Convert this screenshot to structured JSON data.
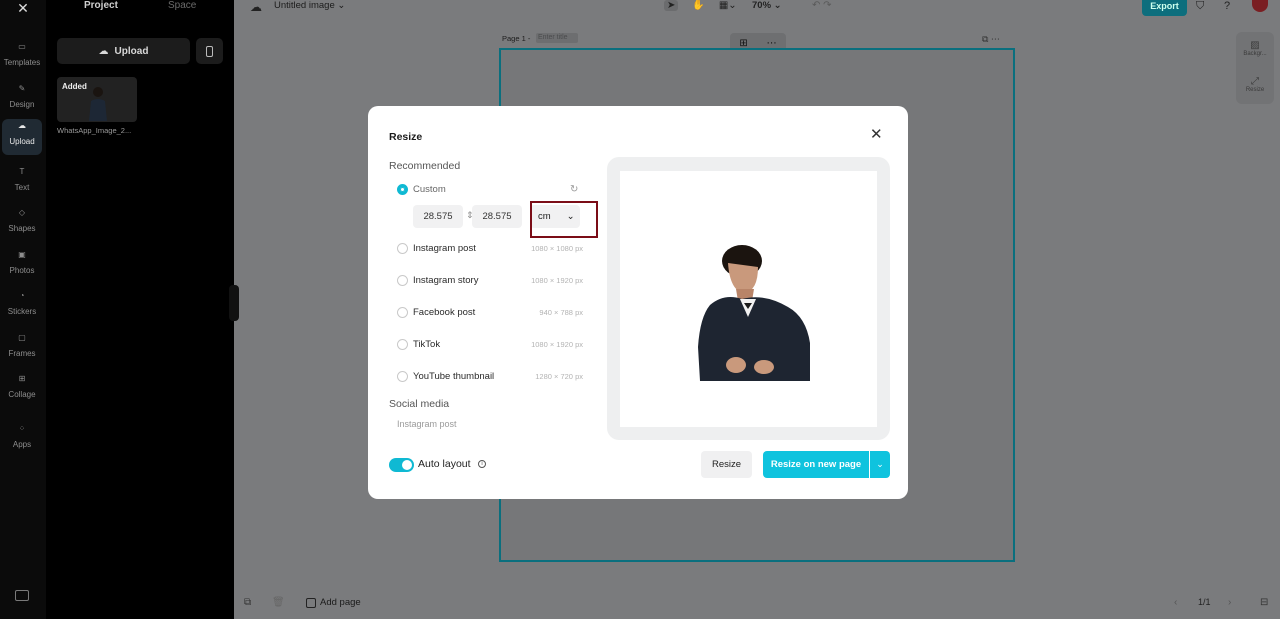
{
  "rail": {
    "items": [
      {
        "label": "Templates",
        "icon": "templates-icon"
      },
      {
        "label": "Design",
        "icon": "design-icon"
      },
      {
        "label": "Upload",
        "icon": "upload-icon"
      },
      {
        "label": "Text",
        "icon": "text-icon"
      },
      {
        "label": "Shapes",
        "icon": "shapes-icon"
      },
      {
        "label": "Photos",
        "icon": "photos-icon"
      },
      {
        "label": "Stickers",
        "icon": "stickers-icon"
      },
      {
        "label": "Frames",
        "icon": "frames-icon"
      },
      {
        "label": "Collage",
        "icon": "collage-icon"
      },
      {
        "label": "Apps",
        "icon": "apps-icon"
      }
    ],
    "active": "Upload"
  },
  "panel": {
    "tabs": [
      "Project",
      "Space"
    ],
    "upload_label": "Upload",
    "asset": {
      "badge": "Added",
      "name": "WhatsApp_Image_2..."
    }
  },
  "topbar": {
    "doc_title": "Untitled image",
    "zoom": "70%",
    "export_label": "Export"
  },
  "canvas": {
    "page_label": "Page 1 -",
    "page_title_placeholder": "Enter title"
  },
  "right_tools": {
    "background_label": "Backgr...",
    "resize_label": "Resize"
  },
  "bottombar": {
    "add_page_label": "Add page",
    "pager": "1/1"
  },
  "modal": {
    "title": "Resize",
    "recommended_label": "Recommended",
    "custom_label": "Custom",
    "width_value": "28.575",
    "height_value": "28.575",
    "unit_value": "cm",
    "presets": [
      {
        "label": "Instagram post",
        "size": "1080 × 1080 px"
      },
      {
        "label": "Instagram story",
        "size": "1080 × 1920 px"
      },
      {
        "label": "Facebook post",
        "size": "940 × 788 px"
      },
      {
        "label": "TikTok",
        "size": "1080 × 1920 px"
      },
      {
        "label": "YouTube thumbnail",
        "size": "1280 × 720 px"
      }
    ],
    "social_label": "Social media",
    "social_option": "Instagram post",
    "auto_layout_label": "Auto layout",
    "resize_button": "Resize",
    "resize_new_page_button": "Resize on new page"
  },
  "colors": {
    "accent": "#0fc3de",
    "highlight": "#7b0d17",
    "canvas_border": "#0a6f7e"
  }
}
